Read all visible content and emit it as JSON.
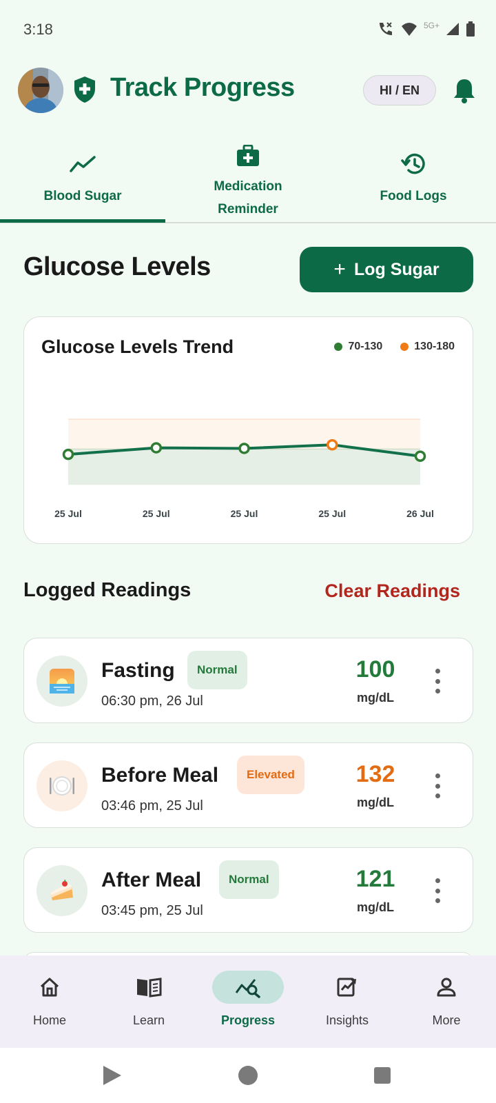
{
  "status_bar": {
    "time": "3:18",
    "network": "5G+"
  },
  "header": {
    "title": "Track Progress",
    "language_toggle": "HI / EN"
  },
  "tabs": [
    {
      "label": "Blood Sugar",
      "icon": "trend-line-icon",
      "active": true
    },
    {
      "label_line1": "Medication",
      "label_line2": "Reminder",
      "icon": "medical-bag-icon"
    },
    {
      "label": "Food Logs",
      "icon": "history-icon"
    }
  ],
  "main": {
    "section_title": "Glucose Levels",
    "log_button": "Log Sugar"
  },
  "chart": {
    "title": "Glucose Levels Trend",
    "legend": [
      {
        "label": "70-130",
        "color": "#2e7d32"
      },
      {
        "label": "130-180",
        "color": "#ef7a16"
      }
    ]
  },
  "chart_data": {
    "type": "line",
    "x": [
      "25 Jul",
      "25 Jul",
      "25 Jul",
      "25 Jul",
      "26 Jul"
    ],
    "series": [
      {
        "values": [
          121,
          132,
          131,
          137,
          118
        ]
      }
    ],
    "bands": [
      {
        "label": "70-130",
        "range": [
          70,
          130
        ],
        "color": "#2e7d32"
      },
      {
        "label": "130-180",
        "range": [
          130,
          180
        ],
        "color": "#ef7a16"
      }
    ],
    "point_colors": [
      "#2e7d32",
      "#2e7d32",
      "#2e7d32",
      "#ef7a16",
      "#2e7d32"
    ],
    "ylim": [
      60,
      180
    ],
    "title": "Glucose Levels Trend",
    "legend_position": "top-right"
  },
  "readings": {
    "title": "Logged Readings",
    "clear_label": "Clear Readings",
    "items": [
      {
        "name": "Fasting",
        "status": "Normal",
        "time": "06:30 pm, 26 Jul",
        "value": "100",
        "unit": "mg/dL",
        "icon": "sunrise-icon",
        "value_color": "#237a3b"
      },
      {
        "name": "Before Meal",
        "status": "Elevated",
        "time": "03:46 pm, 25 Jul",
        "value": "132",
        "unit": "mg/dL",
        "icon": "plate-icon",
        "value_color": "#e36b12"
      },
      {
        "name": "After Meal",
        "status": "Normal",
        "time": "03:45 pm, 25 Jul",
        "value": "121",
        "unit": "mg/dL",
        "icon": "cake-icon",
        "value_color": "#237a3b"
      }
    ]
  },
  "bottom_nav": [
    {
      "label": "Home",
      "icon": "home-icon"
    },
    {
      "label": "Learn",
      "icon": "book-icon"
    },
    {
      "label": "Progress",
      "icon": "progress-chart-icon",
      "active": true
    },
    {
      "label": "Insights",
      "icon": "insights-icon"
    },
    {
      "label": "More",
      "icon": "person-icon"
    }
  ]
}
